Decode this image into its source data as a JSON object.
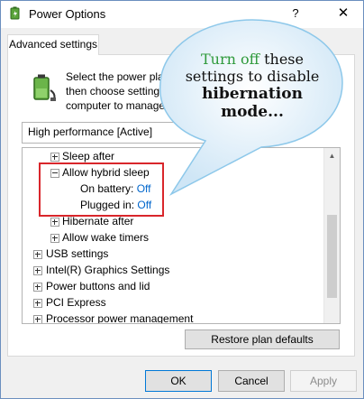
{
  "window": {
    "title": "Power Options",
    "help": "?",
    "close": "✕"
  },
  "tab": {
    "label": "Advanced settings"
  },
  "description": "Select the power plan that you want to customize, and then choose settings that reflect how you want your computer to manage power.",
  "plan": {
    "selected": "High performance [Active]"
  },
  "tree": {
    "rows": [
      {
        "label": "Sleep after"
      },
      {
        "label": "Allow hybrid sleep"
      },
      {
        "label": "On battery:",
        "value": "Off"
      },
      {
        "label": "Plugged in:",
        "value": "Off"
      },
      {
        "label": "Hibernate after"
      },
      {
        "label": "Allow wake timers"
      },
      {
        "label": "USB settings"
      },
      {
        "label": "Intel(R) Graphics Settings"
      },
      {
        "label": "Power buttons and lid"
      },
      {
        "label": "PCI Express"
      },
      {
        "label": "Processor power management"
      }
    ]
  },
  "buttons": {
    "restore": "Restore plan defaults",
    "ok": "OK",
    "cancel": "Cancel",
    "apply": "Apply"
  },
  "callout": {
    "green": "Turn off",
    "line1_rest": " these",
    "line2": "settings to disable",
    "line3": "hibernation",
    "line4": "mode..."
  },
  "colors": {
    "link": "#0066cc",
    "highlight": "#d9262b",
    "callout_green": "#2e9a3b",
    "bubble_fill": "#d7ecf8",
    "bubble_stroke": "#8dc8ea"
  }
}
